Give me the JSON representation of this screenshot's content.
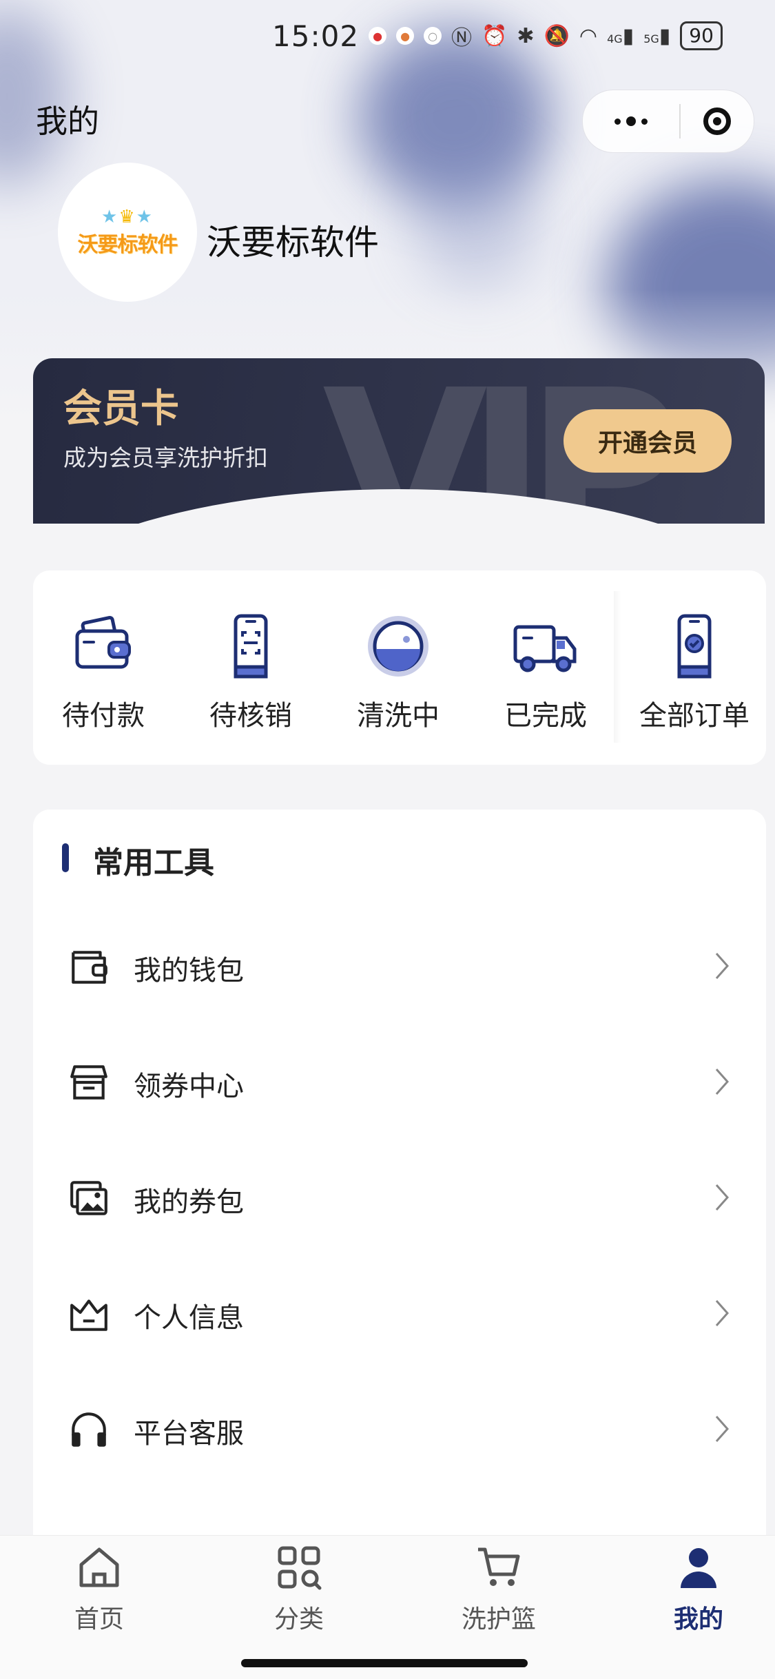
{
  "status_bar": {
    "time": "15:02",
    "network_4g": "4G",
    "network_5g": "5G",
    "battery": "90"
  },
  "header": {
    "title": "我的"
  },
  "profile": {
    "logo_text": "沃要标软件",
    "username": "沃要标软件"
  },
  "vip": {
    "title": "会员卡",
    "subtitle": "成为会员享洗护折扣",
    "button": "开通会员",
    "watermark": "VIP"
  },
  "orders": [
    {
      "label": "待付款",
      "icon": "wallet-icon"
    },
    {
      "label": "待核销",
      "icon": "phone-scan-icon"
    },
    {
      "label": "清洗中",
      "icon": "washing-machine-icon"
    },
    {
      "label": "已完成",
      "icon": "delivery-truck-icon"
    },
    {
      "label": "全部订单",
      "icon": "phone-check-icon"
    }
  ],
  "tools": {
    "title": "常用工具",
    "items": [
      {
        "label": "我的钱包",
        "icon": "wallet-outline-icon"
      },
      {
        "label": "领券中心",
        "icon": "store-icon"
      },
      {
        "label": "我的券包",
        "icon": "image-icon"
      },
      {
        "label": "个人信息",
        "icon": "crown-icon"
      },
      {
        "label": "平台客服",
        "icon": "headphones-icon"
      }
    ]
  },
  "tabbar": [
    {
      "label": "首页",
      "icon": "home-icon"
    },
    {
      "label": "分类",
      "icon": "category-icon"
    },
    {
      "label": "洗护篮",
      "icon": "cart-icon"
    },
    {
      "label": "我的",
      "icon": "user-icon",
      "active": true
    }
  ],
  "colors": {
    "accent": "#1d2e73",
    "vip_gold": "#ecc58d",
    "vip_button": "#f0c98e",
    "vip_bg": "#2b2f45"
  }
}
